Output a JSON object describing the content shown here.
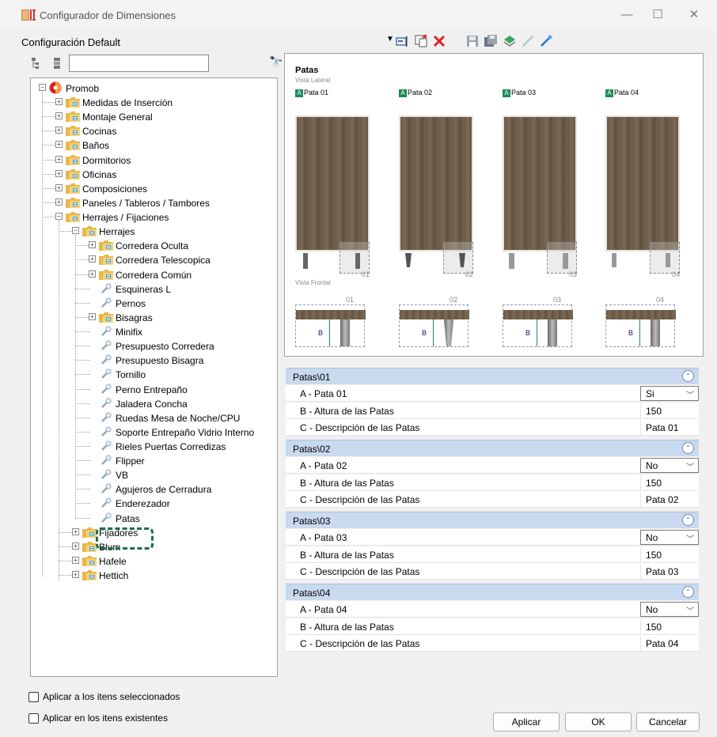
{
  "window": {
    "title": "Configurador de Dimensiones",
    "minimize": "—",
    "maximize": "☐",
    "close": "✕"
  },
  "config": {
    "label": "Configuración Default"
  },
  "tree": {
    "items": [
      {
        "label": "Promob",
        "level": 0,
        "icon": "promob-icon",
        "expander": "−"
      },
      {
        "label": "Medidas de Inserción",
        "level": 1,
        "icon": "folder-icon",
        "expander": "+"
      },
      {
        "label": "Montaje General",
        "level": 1,
        "icon": "folder-icon",
        "expander": "+"
      },
      {
        "label": "Cocinas",
        "level": 1,
        "icon": "folder-icon",
        "expander": "+"
      },
      {
        "label": "Baños",
        "level": 1,
        "icon": "folder-icon",
        "expander": "+"
      },
      {
        "label": "Dormitorios",
        "level": 1,
        "icon": "folder-icon",
        "expander": "+"
      },
      {
        "label": "Oficinas",
        "level": 1,
        "icon": "folder-icon",
        "expander": "+"
      },
      {
        "label": "Composiciones",
        "level": 1,
        "icon": "folder-icon",
        "expander": "+"
      },
      {
        "label": "Paneles / Tableros / Tambores",
        "level": 1,
        "icon": "folder-icon",
        "expander": "+"
      },
      {
        "label": "Herrajes / Fijaciones",
        "level": 1,
        "icon": "folder-icon",
        "expander": "−"
      },
      {
        "label": "Herrajes",
        "level": 2,
        "icon": "folder-icon",
        "expander": "−"
      },
      {
        "label": "Corredera Oculta",
        "level": 3,
        "icon": "folder-icon",
        "expander": "+"
      },
      {
        "label": "Corredera Telescopica",
        "level": 3,
        "icon": "folder-icon",
        "expander": "+"
      },
      {
        "label": "Corredera Común",
        "level": 3,
        "icon": "folder-icon",
        "expander": "+"
      },
      {
        "label": "Esquineras L",
        "level": 3,
        "icon": "pin-icon",
        "expander": ""
      },
      {
        "label": "Pernos",
        "level": 3,
        "icon": "pin-icon",
        "expander": ""
      },
      {
        "label": "Bisagras",
        "level": 3,
        "icon": "folder-icon",
        "expander": "+"
      },
      {
        "label": "Minifix",
        "level": 3,
        "icon": "pin-icon",
        "expander": ""
      },
      {
        "label": "Presupuesto Corredera",
        "level": 3,
        "icon": "pin-icon",
        "expander": ""
      },
      {
        "label": "Presupuesto Bisagra",
        "level": 3,
        "icon": "pin-icon",
        "expander": ""
      },
      {
        "label": "Tornillo",
        "level": 3,
        "icon": "pin-icon",
        "expander": ""
      },
      {
        "label": "Perno Entrepaño",
        "level": 3,
        "icon": "pin-icon",
        "expander": ""
      },
      {
        "label": "Jaladera Concha",
        "level": 3,
        "icon": "pin-icon",
        "expander": ""
      },
      {
        "label": "Ruedas Mesa de Noche/CPU",
        "level": 3,
        "icon": "pin-icon",
        "expander": ""
      },
      {
        "label": "Soporte Entrepaño Vidrio Interno",
        "level": 3,
        "icon": "pin-icon",
        "expander": ""
      },
      {
        "label": "Rieles Puertas Corredizas",
        "level": 3,
        "icon": "pin-icon",
        "expander": ""
      },
      {
        "label": "Flipper",
        "level": 3,
        "icon": "pin-icon",
        "expander": ""
      },
      {
        "label": "VB",
        "level": 3,
        "icon": "pin-icon",
        "expander": ""
      },
      {
        "label": "Agujeros de Cerradura",
        "level": 3,
        "icon": "pin-icon",
        "expander": ""
      },
      {
        "label": "Enderezador",
        "level": 3,
        "icon": "pin-icon",
        "expander": ""
      },
      {
        "label": "Patas",
        "level": 3,
        "icon": "pin-icon",
        "expander": ""
      },
      {
        "label": "Fijadores",
        "level": 2,
        "icon": "folder-icon",
        "expander": "+"
      },
      {
        "label": "Blum",
        "level": 2,
        "icon": "folder-icon",
        "expander": "+"
      },
      {
        "label": "Hafele",
        "level": 2,
        "icon": "folder-icon",
        "expander": "+"
      },
      {
        "label": "Hettich",
        "level": 2,
        "icon": "folder-icon",
        "expander": "+"
      }
    ]
  },
  "options": {
    "apply_selected": "Aplicar a los itens seleccionados",
    "apply_existing": "Aplicar en los itens existentes"
  },
  "preview": {
    "title": "Patas",
    "side_view": "Vista Lateral",
    "front_view": "Vista Frontal",
    "badge": "A",
    "legs": [
      {
        "label": "Pata 01",
        "num": "01",
        "b": "B"
      },
      {
        "label": "Pata 02",
        "num": "02",
        "b": "B"
      },
      {
        "label": "Pata 03",
        "num": "03",
        "b": "B"
      },
      {
        "label": "Pata 04",
        "num": "04",
        "b": "B"
      }
    ]
  },
  "sections": [
    {
      "title": "Patas\\01",
      "rows": [
        {
          "name": "A - Pata 01",
          "value": "Si",
          "type": "select"
        },
        {
          "name": "B - Altura de las Patas",
          "value": "150",
          "type": "text"
        },
        {
          "name": "C - Descripción de las Patas",
          "value": "Pata 01",
          "type": "text"
        }
      ]
    },
    {
      "title": "Patas\\02",
      "rows": [
        {
          "name": "A - Pata 02",
          "value": "No",
          "type": "select"
        },
        {
          "name": "B - Altura de las Patas",
          "value": "150",
          "type": "text"
        },
        {
          "name": "C - Descripción de las Patas",
          "value": "Pata 02",
          "type": "text"
        }
      ]
    },
    {
      "title": "Patas\\03",
      "rows": [
        {
          "name": "A - Pata 03",
          "value": "No",
          "type": "select"
        },
        {
          "name": "B - Altura de las Patas",
          "value": "150",
          "type": "text"
        },
        {
          "name": "C - Descripción de las Patas",
          "value": "Pata 03",
          "type": "text"
        }
      ]
    },
    {
      "title": "Patas\\04",
      "rows": [
        {
          "name": "A - Pata 04",
          "value": "No",
          "type": "select"
        },
        {
          "name": "B - Altura de las Patas",
          "value": "150",
          "type": "text"
        },
        {
          "name": "C - Descripción de las Patas",
          "value": "Pata 04",
          "type": "text"
        }
      ]
    }
  ],
  "buttons": {
    "apply": "Aplicar",
    "ok": "OK",
    "cancel": "Cancelar"
  },
  "colors": {
    "accent_green": "#1c8a5c",
    "section_header": "#c9d9ee",
    "highlight": "#1d6b50"
  }
}
